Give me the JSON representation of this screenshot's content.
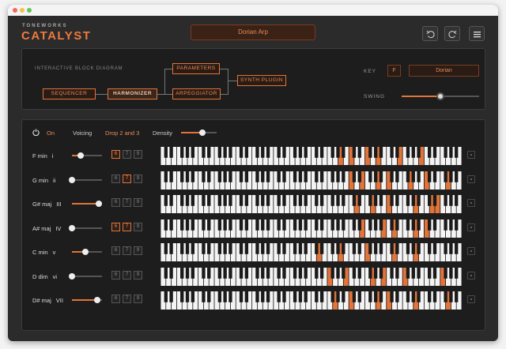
{
  "brand": {
    "small": "TONEWORKS",
    "name": "CATALYST"
  },
  "preset_name": "Dorian Arp",
  "header_icons": [
    "undo-icon",
    "redo-icon",
    "menu-icon"
  ],
  "diagram": {
    "label": "INTERACTIVE BLOCK DIAGRAM",
    "blocks": {
      "sequencer": "SEQUENCER",
      "harmonizer": "HARMONIZER",
      "parameters": "PARAMETERS",
      "arpeggiator": "ARPEGGIATOR",
      "synth_plugin": "SYNTH PLUGIN"
    },
    "selected": "harmonizer"
  },
  "key": {
    "label": "KEY",
    "value": "F",
    "mode": "Dorian"
  },
  "swing": {
    "label": "SWING",
    "value": 0.5
  },
  "controls": {
    "on_label": "On",
    "voicing_label": "Voicing",
    "voicing_value": "Drop 2 and 3",
    "density_label": "Density",
    "density_value": 0.6
  },
  "colors": {
    "accent": "#e0743a",
    "background": "#1d1d1d",
    "key_highlight": "#e0743a"
  },
  "chords": [
    {
      "name": "F min",
      "numeral": "i",
      "velocity": 0.3,
      "ext": [
        "6",
        "7",
        "9"
      ],
      "ext_on": [
        true,
        false,
        false
      ],
      "highlight": [
        33,
        35,
        38,
        40,
        44,
        48,
        56
      ]
    },
    {
      "name": "G min",
      "numeral": "ii",
      "velocity": 0.0,
      "ext": [
        "6",
        "7",
        "9"
      ],
      "ext_on": [
        false,
        true,
        false
      ],
      "highlight": [
        35,
        37,
        40,
        42,
        46,
        49,
        53
      ]
    },
    {
      "name": "G# maj",
      "numeral": "III",
      "velocity": 0.9,
      "ext": [
        "6",
        "7",
        "9"
      ],
      "ext_on": [
        false,
        false,
        false
      ],
      "highlight": [
        36,
        39,
        42,
        47,
        50,
        51
      ]
    },
    {
      "name": "A# maj",
      "numeral": "IV",
      "velocity": 0.0,
      "ext": [
        "6",
        "7",
        "9"
      ],
      "ext_on": [
        true,
        true,
        false
      ],
      "highlight": [
        37,
        41,
        43,
        47,
        49,
        56
      ]
    },
    {
      "name": "C min",
      "numeral": "v",
      "velocity": 0.45,
      "ext": [
        "6",
        "7",
        "9"
      ],
      "ext_on": [
        false,
        false,
        false
      ],
      "highlight": [
        29,
        33,
        38,
        43,
        47
      ]
    },
    {
      "name": "D dim",
      "numeral": "vi",
      "velocity": 0.0,
      "ext": [
        "6",
        "7",
        "9"
      ],
      "ext_on": [
        false,
        false,
        false
      ],
      "highlight": [
        31,
        34,
        39,
        41,
        45,
        52
      ]
    },
    {
      "name": "D# maj",
      "numeral": "VII",
      "velocity": 0.85,
      "ext": [
        "6",
        "7",
        "9"
      ],
      "ext_on": [
        false,
        false,
        false
      ],
      "highlight": [
        32,
        35,
        40,
        42,
        47,
        53
      ]
    }
  ]
}
